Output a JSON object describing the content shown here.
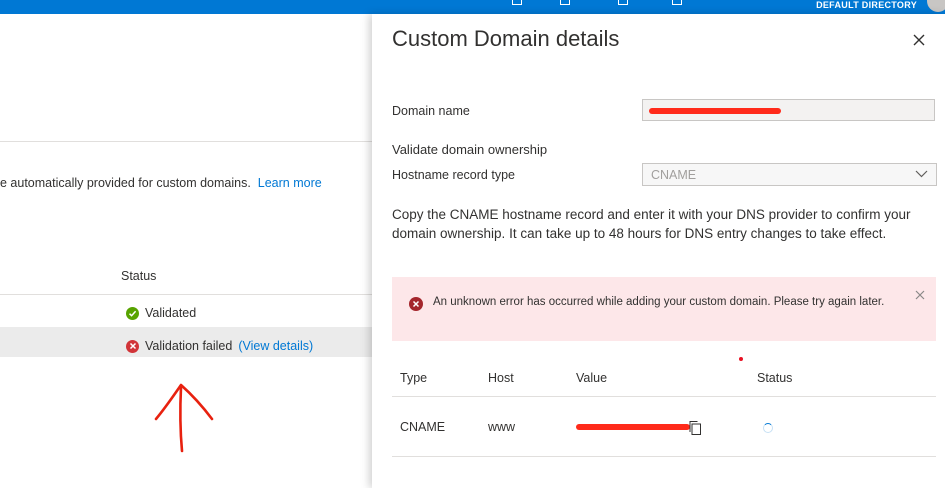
{
  "topbar": {
    "directory_label": "DEFAULT DIRECTORY",
    "color": "#0078d4"
  },
  "background_page": {
    "info_text": "e automatically provided for custom domains.",
    "learn_more": "Learn more",
    "status_header": "Status",
    "rows": [
      {
        "status": "Validated",
        "icon": "check-circle-icon"
      },
      {
        "status": "Validation failed",
        "link": "(View details)",
        "icon": "error-circle-icon"
      }
    ]
  },
  "panel": {
    "title": "Custom Domain details",
    "domain_name_label": "Domain name",
    "validate_heading": "Validate domain ownership",
    "hostname_record_label": "Hostname record type",
    "hostname_record_value": "CNAME",
    "description": "Copy the CNAME hostname record and enter it with your DNS provider to confirm your domain ownership. It can take up to 48 hours for DNS entry changes to take effect.",
    "error_message": "An unknown error has occurred while adding your custom domain. Please try again later.",
    "table": {
      "headers": {
        "type": "Type",
        "host": "Host",
        "value": "Value",
        "status": "Status"
      },
      "row": {
        "type": "CNAME",
        "host": "www"
      }
    }
  },
  "colors": {
    "accent": "#0078d4",
    "success": "#57a300",
    "error": "#d13438",
    "error_bg": "#fde7e9",
    "annotation": "#e8210f"
  }
}
